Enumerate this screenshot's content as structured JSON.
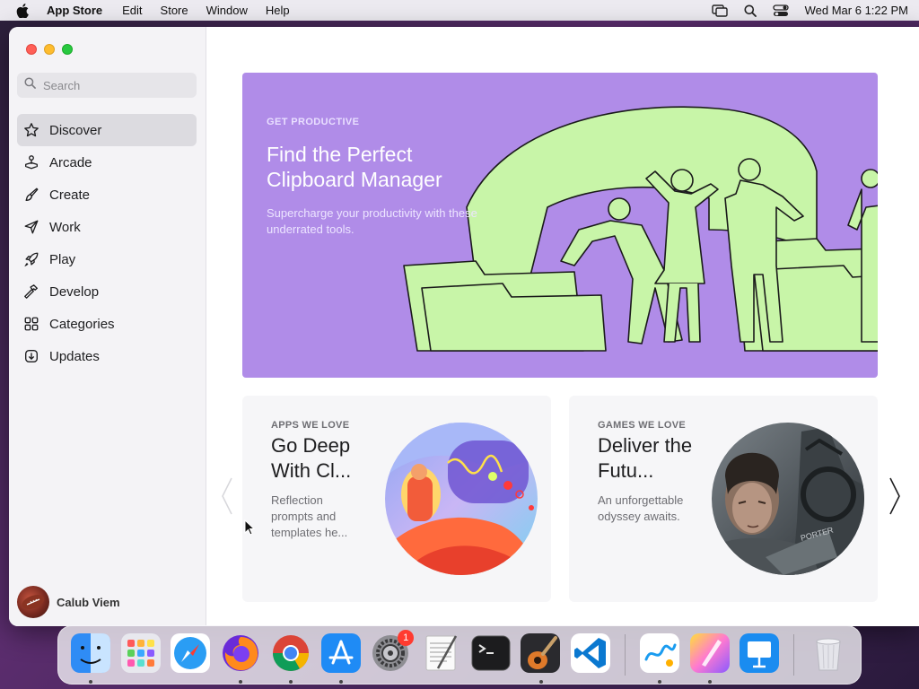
{
  "menubar": {
    "app_name": "App Store",
    "items": [
      "Edit",
      "Store",
      "Window",
      "Help"
    ],
    "datetime": "Wed Mar 6  1:22 PM"
  },
  "sidebar": {
    "search_placeholder": "Search",
    "items": [
      {
        "label": "Discover",
        "icon": "star-icon",
        "active": true
      },
      {
        "label": "Arcade",
        "icon": "joystick-icon"
      },
      {
        "label": "Create",
        "icon": "paintbrush-icon"
      },
      {
        "label": "Work",
        "icon": "paperplane-icon"
      },
      {
        "label": "Play",
        "icon": "rocket-icon"
      },
      {
        "label": "Develop",
        "icon": "hammer-icon"
      },
      {
        "label": "Categories",
        "icon": "grid-icon"
      },
      {
        "label": "Updates",
        "icon": "download-icon"
      }
    ],
    "user_name": "Calub Viem"
  },
  "hero": {
    "eyebrow": "GET PRODUCTIVE",
    "title": "Find the Perfect Clipboard Manager",
    "subtitle": "Supercharge your productivity with these underrated tools.",
    "bg_color": "#b08ce8",
    "art_color": "#c8f5a8"
  },
  "cards": [
    {
      "eyebrow": "APPS WE LOVE",
      "title": "Go Deep With Cl...",
      "description": "Reflection prompts and templates he..."
    },
    {
      "eyebrow": "GAMES WE LOVE",
      "title": "Deliver the Futu...",
      "description": "An unforgettable odyssey awaits."
    }
  ],
  "dock": {
    "apps": [
      "finder-icon",
      "launchpad-icon",
      "safari-icon",
      "firefox-icon",
      "chrome-icon",
      "app-store-icon",
      "system-settings-icon",
      "textedit-icon",
      "terminal-icon",
      "garageband-icon",
      "vscode-icon",
      "freeform-icon",
      "pages-icon",
      "keynote-icon",
      "trash-icon"
    ],
    "settings_badge": "1"
  }
}
